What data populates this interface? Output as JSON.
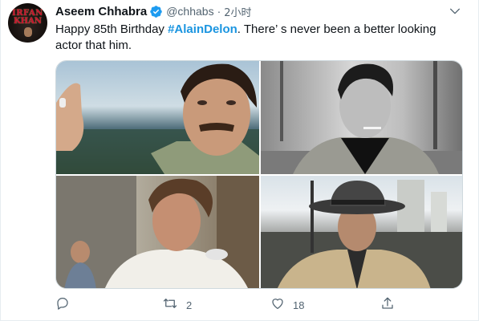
{
  "tweet": {
    "avatar": {
      "logo_line1": "IRFAN",
      "logo_line2": "KHAN"
    },
    "author": {
      "display_name": "Aseem Chhabra",
      "handle": "@chhabs",
      "separator": "·",
      "time": "2小时",
      "verified": true
    },
    "text": {
      "part1": "Happy 85th Birthday ",
      "hashtag": "#AlainDelon",
      "part2": ". There’ s never been a better looking actor that him."
    },
    "media": [
      {
        "icon": "photo-alain-delon-close-up-color"
      },
      {
        "icon": "photo-alain-delon-cigarette-bw"
      },
      {
        "icon": "photo-alain-delon-white-shirt"
      },
      {
        "icon": "photo-alain-delon-fedora-trenchcoat"
      }
    ],
    "actions": {
      "reply_count": "",
      "retweet_count": "2",
      "like_count": "18"
    },
    "colors": {
      "accent": "#1b95e0",
      "icon_gray": "#536471",
      "verified": "#1d9bf0"
    }
  }
}
